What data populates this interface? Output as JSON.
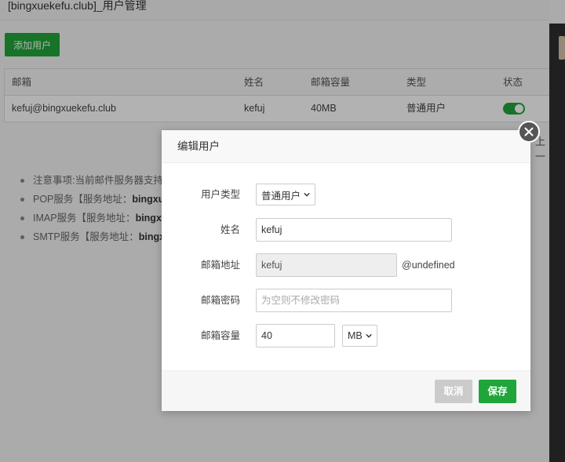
{
  "page": {
    "title": "[bingxuekefu.club]_用户管理",
    "add_user_label": "添加用户",
    "pager_fragment": "上一",
    "table": {
      "headers": [
        "邮箱",
        "姓名",
        "邮箱容量",
        "类型",
        "状态"
      ],
      "rows": [
        {
          "email": "kefuj@bingxuekefu.club",
          "name": "kefuj",
          "quota": "40MB",
          "type": "普通用户",
          "status_on": true
        }
      ]
    },
    "notes": [
      {
        "text": "注意事项:当前邮件服务器支持I",
        "bold": ""
      },
      {
        "text": "POP服务【服务地址：",
        "bold": "bingxu"
      },
      {
        "text": "IMAP服务【服务地址：",
        "bold": "bingx"
      },
      {
        "text": "SMTP服务【服务地址：",
        "bold": "bingx"
      }
    ]
  },
  "modal": {
    "title": "编辑用户",
    "fields": {
      "user_type": {
        "label": "用户类型",
        "value": "普通用户"
      },
      "name": {
        "label": "姓名",
        "value": "kefuj"
      },
      "email": {
        "label": "邮箱地址",
        "value": "kefuj",
        "suffix": "@undefined"
      },
      "password": {
        "label": "邮箱密码",
        "placeholder": "为空则不修改密码"
      },
      "quota": {
        "label": "邮箱容量",
        "value": "40",
        "unit": "MB"
      }
    },
    "cancel_label": "取消",
    "save_label": "保存"
  },
  "colors": {
    "accent": "#20a53a",
    "cancel": "#cbcbcb"
  },
  "icons": {
    "close": "close-icon",
    "dropdown": "chevron-down-icon"
  }
}
